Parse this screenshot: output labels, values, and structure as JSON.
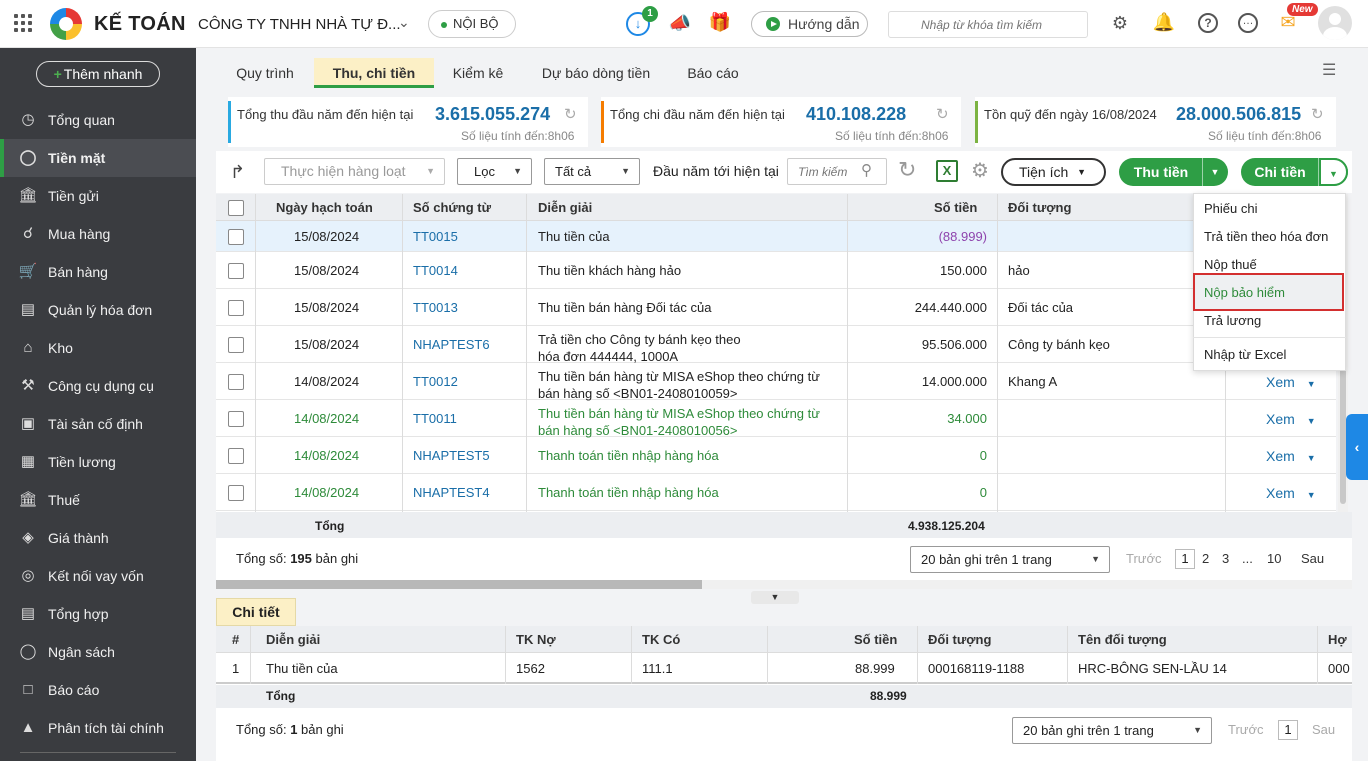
{
  "header": {
    "logo_text": "KẾ TOÁN",
    "company": "CÔNG TY TNHH NHÀ TỰ Đ...",
    "scope": "NỘI BỘ",
    "download_badge": "1",
    "guide_label": "Hướng dẫn",
    "search_placeholder": "Nhập từ khóa tìm kiếm",
    "new_badge": "New"
  },
  "sidebar": {
    "add_label": "Thêm nhanh",
    "items": [
      {
        "label": "Tổng quan",
        "icon": "dashboard-icon"
      },
      {
        "label": "Tiền mặt",
        "icon": "cash-icon",
        "active": true
      },
      {
        "label": "Tiền gửi",
        "icon": "bank-icon"
      },
      {
        "label": "Mua hàng",
        "icon": "bag-icon"
      },
      {
        "label": "Bán hàng",
        "icon": "cart-icon"
      },
      {
        "label": "Quản lý hóa đơn",
        "icon": "invoice-icon"
      },
      {
        "label": "Kho",
        "icon": "warehouse-icon"
      },
      {
        "label": "Công cụ dụng cụ",
        "icon": "tools-icon"
      },
      {
        "label": "Tài sản cố định",
        "icon": "asset-icon"
      },
      {
        "label": "Tiền lương",
        "icon": "salary-icon"
      },
      {
        "label": "Thuế",
        "icon": "tax-icon"
      },
      {
        "label": "Giá thành",
        "icon": "price-tag-icon"
      },
      {
        "label": "Kết nối vay vốn",
        "icon": "loan-icon"
      },
      {
        "label": "Tổng hợp",
        "icon": "summary-icon"
      },
      {
        "label": "Ngân sách",
        "icon": "budget-icon"
      },
      {
        "label": "Báo cáo",
        "icon": "report-icon"
      },
      {
        "label": "Phân tích tài chính",
        "icon": "analytics-icon"
      }
    ]
  },
  "tabs": [
    "Quy trình",
    "Thu, chi tiền",
    "Kiểm kê",
    "Dự báo dòng tiền",
    "Báo cáo"
  ],
  "active_tab": "Thu, chi tiền",
  "summary": [
    {
      "label": "Tổng thu đầu năm đến hiện tại",
      "value": "3.615.055.274",
      "sub": "Số liệu tính đến:8h06",
      "color": "#29a9e1"
    },
    {
      "label": "Tổng chi đầu năm đến hiện tại",
      "value": "410.108.228",
      "sub": "Số liệu tính đến:8h06",
      "color": "#f57c00"
    },
    {
      "label": "Tồn quỹ đến ngày 16/08/2024",
      "value": "28.000.506.815",
      "sub": "Số liệu tính đến:8h06",
      "color": "#7cb342"
    }
  ],
  "toolbar": {
    "bulk_action": "Thực hiện hàng loạt",
    "filter": "Lọc",
    "all": "Tất cả",
    "period": "Đầu năm tới hiện tại",
    "search_placeholder": "Tìm kiếm",
    "utilities": "Tiện ích",
    "receive": "Thu tiền",
    "spend": "Chi tiền"
  },
  "table": {
    "columns": [
      "Ngày hạch toán",
      "Số chứng từ",
      "Diễn giải",
      "Số tiền",
      "Đối tượng"
    ],
    "rows": [
      {
        "date": "15/08/2024",
        "doc": "TT0015",
        "desc": "Thu tiền của",
        "amount": "(88.999)",
        "party": "",
        "style": "selected"
      },
      {
        "date": "15/08/2024",
        "doc": "TT0014",
        "desc": "Thu tiền khách hàng hảo",
        "amount": "150.000",
        "party": "hảo",
        "style": ""
      },
      {
        "date": "15/08/2024",
        "doc": "TT0013",
        "desc": "Thu tiền bán hàng Đối tác của",
        "amount": "244.440.000",
        "party": "Đối tác của",
        "style": ""
      },
      {
        "date": "15/08/2024",
        "doc": "NHAPTEST6",
        "desc": "Trả tiền cho Công ty bánh kẹo                theo",
        "desc2": "hóa đơn 444444, 1000A",
        "amount": "95.506.000",
        "party": "Công ty bánh kẹo",
        "style": ""
      },
      {
        "date": "14/08/2024",
        "doc": "TT0012",
        "desc": "Thu tiền bán hàng từ MISA eShop theo chứng từ",
        "desc2": "bán hàng số <BN01-2408010059>",
        "amount": "14.000.000",
        "party": "Khang A",
        "style": "",
        "action": "Xem"
      },
      {
        "date": "14/08/2024",
        "doc": "TT0011",
        "desc": "Thu tiền bán hàng từ MISA eShop theo chứng từ",
        "desc2": "bán hàng số <BN01-2408010056>",
        "amount": "34.000",
        "party": "",
        "style": "green",
        "action": "Xem"
      },
      {
        "date": "14/08/2024",
        "doc": "NHAPTEST5",
        "desc": "Thanh toán tiền nhập hàng hóa",
        "amount": "0",
        "party": "",
        "style": "green",
        "action": "Xem"
      },
      {
        "date": "14/08/2024",
        "doc": "NHAPTEST4",
        "desc": "Thanh toán tiền nhập hàng hóa",
        "amount": "0",
        "party": "",
        "style": "green",
        "action": "Xem"
      }
    ],
    "total_label": "Tổng",
    "total_value": "4.938.125.204",
    "count_prefix": "Tổng số: ",
    "count": "195",
    "count_suffix": " bản ghi",
    "page_size": "20 bản ghi trên 1 trang",
    "prev": "Trước",
    "next": "Sau",
    "pages": [
      "1",
      "2",
      "3",
      "...",
      "10"
    ]
  },
  "dropdown": {
    "items": [
      "Phiếu chi",
      "Trả tiền theo hóa đơn",
      "Nộp thuế",
      "Nộp bảo hiểm",
      "Trả lương",
      "Nhập từ Excel"
    ],
    "highlighted": "Nộp bảo hiểm"
  },
  "detail": {
    "tab": "Chi tiết",
    "columns": [
      "#",
      "Diễn giải",
      "TK Nợ",
      "TK Có",
      "Số tiền",
      "Đối tượng",
      "Tên đối tượng",
      "Hợ"
    ],
    "rows": [
      {
        "no": "1",
        "desc": "Thu tiền của",
        "debit": "1562",
        "credit": "111.1",
        "amount": "88.999",
        "party": "000168119-1188",
        "party_name": "HRC-BÔNG SEN-LẦU 14",
        "extra": "000"
      }
    ],
    "total_label": "Tổng",
    "total_value": "88.999",
    "count_prefix": "Tổng số: ",
    "count": "1",
    "count_suffix": " bản ghi",
    "page_size": "20 bản ghi trên 1 trang",
    "prev": "Trước",
    "page": "1",
    "next": "Sau"
  }
}
